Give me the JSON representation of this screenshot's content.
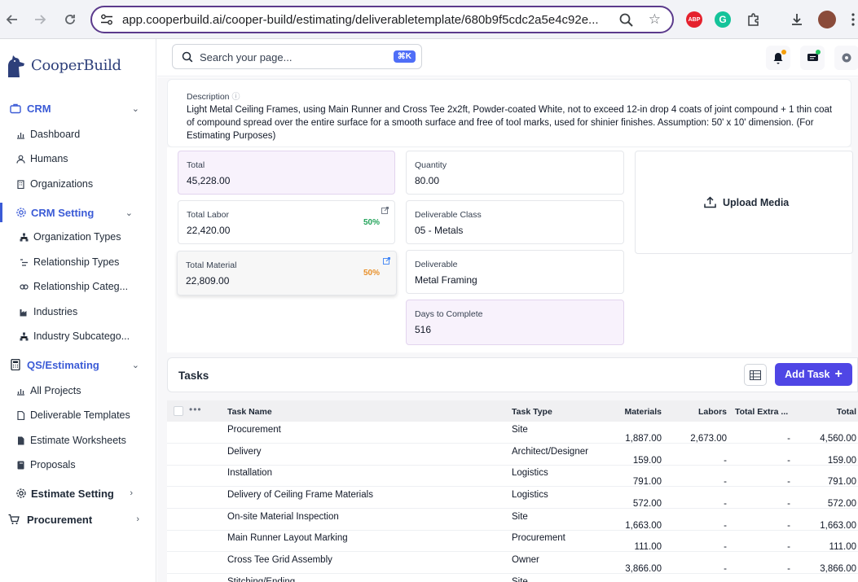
{
  "browser": {
    "url": "app.cooperbuild.ai/cooper-build/estimating/deliverabletemplate/680b9f5cdc2a5e4c92e...",
    "extensions": {
      "adblock": "ABP",
      "grammarly": "G"
    }
  },
  "sidebar": {
    "logo": "CooperBuild",
    "crm": {
      "label": "CRM",
      "items": [
        "Dashboard",
        "Humans",
        "Organizations"
      ]
    },
    "crm_setting": {
      "label": "CRM Setting",
      "items": [
        "Organization Types",
        "Relationship Types",
        "Relationship Categ...",
        "Industries",
        "Industry Subcatego..."
      ]
    },
    "qs": {
      "label": "QS/Estimating",
      "items": [
        "All Projects",
        "Deliverable Templates",
        "Estimate Worksheets",
        "Proposals"
      ]
    },
    "estimate_setting": "Estimate Setting",
    "procurement": "Procurement"
  },
  "topbar": {
    "search_placeholder": "Search your page...",
    "shortcut": "⌘K"
  },
  "description": {
    "label": "Description",
    "text": "Light Metal Ceiling Frames, using Main Runner and Cross Tee 2x2ft, Powder-coated White, not to exceed 12-in drop 4 coats of joint compound + 1 thin coat of compound spread over the entire surface for a smooth surface and free of tool marks, used for shinier finishes. Assumption: 50' x 10' dimension. (For Estimating Purposes)"
  },
  "stats": {
    "total": {
      "label": "Total",
      "value": "45,228.00"
    },
    "total_labor": {
      "label": "Total Labor",
      "value": "22,420.00",
      "pct": "50%"
    },
    "total_material": {
      "label": "Total Material",
      "value": "22,809.00",
      "pct": "50%"
    },
    "quantity": {
      "label": "Quantity",
      "value": "80.00"
    },
    "deliverable_class": {
      "label": "Deliverable Class",
      "value": "05 - Metals"
    },
    "deliverable": {
      "label": "Deliverable",
      "value": "Metal Framing"
    },
    "days": {
      "label": "Days to Complete",
      "value": "516"
    },
    "upload": "Upload Media"
  },
  "tasks": {
    "title": "Tasks",
    "add_label": "Add Task",
    "columns": {
      "name": "Task Name",
      "type": "Task Type",
      "materials": "Materials",
      "labors": "Labors",
      "extra": "Total Extra ...",
      "total": "Total"
    },
    "rows": [
      {
        "name": "Procurement",
        "type": "Site",
        "materials": "1,887.00",
        "labors": "2,673.00",
        "extra": "-",
        "total": "4,560.00"
      },
      {
        "name": "Delivery",
        "type": "Architect/Designer",
        "materials": "159.00",
        "labors": "-",
        "extra": "-",
        "total": "159.00"
      },
      {
        "name": "Installation",
        "type": "Logistics",
        "materials": "791.00",
        "labors": "-",
        "extra": "-",
        "total": "791.00"
      },
      {
        "name": "Delivery of Ceiling Frame Materials",
        "type": "Logistics",
        "materials": "572.00",
        "labors": "-",
        "extra": "-",
        "total": "572.00"
      },
      {
        "name": "On-site Material Inspection",
        "type": "Site",
        "materials": "1,663.00",
        "labors": "-",
        "extra": "-",
        "total": "1,663.00"
      },
      {
        "name": "Main Runner Layout Marking",
        "type": "Procurement",
        "materials": "111.00",
        "labors": "-",
        "extra": "-",
        "total": "111.00"
      },
      {
        "name": "Cross Tee Grid Assembly",
        "type": "Owner",
        "materials": "3,866.00",
        "labors": "-",
        "extra": "-",
        "total": "3,866.00"
      },
      {
        "name": "Stitching/Ending...",
        "type": "Site",
        "materials": "",
        "labors": "",
        "extra": "",
        "total": ""
      }
    ]
  },
  "colors": {
    "accent": "#3b5bd6",
    "primary_button": "#4f46e5",
    "labor_pct": "#22a35a",
    "material_pct": "#e8902a",
    "card_purple": "#f8f2fc"
  }
}
